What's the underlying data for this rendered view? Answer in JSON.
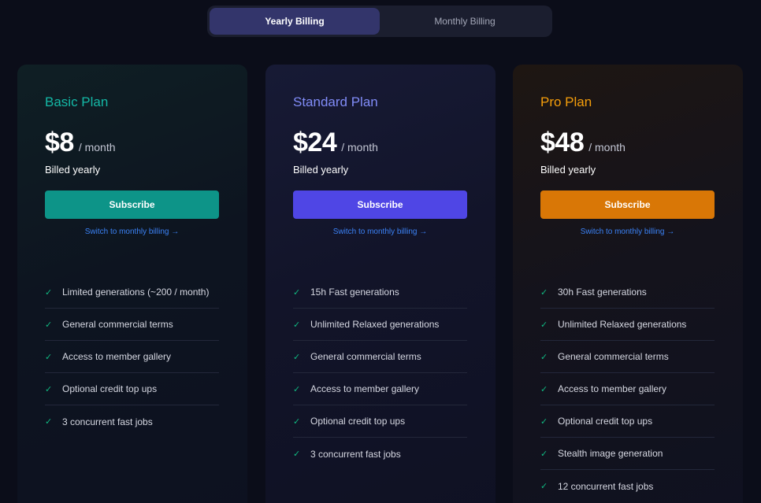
{
  "billing_toggle": {
    "yearly_label": "Yearly Billing",
    "monthly_label": "Monthly Billing",
    "selected": "yearly"
  },
  "colors": {
    "basic_accent": "#14b8a6",
    "basic_button": "#0d9488",
    "standard_accent": "#818cf8",
    "standard_button": "#4f46e5",
    "pro_accent": "#f59e0b",
    "pro_button": "#d97706",
    "check": "#10b981",
    "link": "#3b82f6"
  },
  "plans": [
    {
      "name": "Basic Plan",
      "price": "$8",
      "period": "/ month",
      "billed": "Billed yearly",
      "button": "Subscribe",
      "switch_link": "Switch to monthly billing →",
      "features": [
        "Limited generations (~200 / month)",
        "General commercial terms",
        "Access to member gallery",
        "Optional credit top ups",
        "3 concurrent fast jobs"
      ]
    },
    {
      "name": "Standard Plan",
      "price": "$24",
      "period": "/ month",
      "billed": "Billed yearly",
      "button": "Subscribe",
      "switch_link": "Switch to monthly billing →",
      "features": [
        "15h Fast generations",
        "Unlimited Relaxed generations",
        "General commercial terms",
        "Access to member gallery",
        "Optional credit top ups",
        "3 concurrent fast jobs"
      ]
    },
    {
      "name": "Pro Plan",
      "price": "$48",
      "period": "/ month",
      "billed": "Billed yearly",
      "button": "Subscribe",
      "switch_link": "Switch to monthly billing →",
      "features": [
        "30h Fast generations",
        "Unlimited Relaxed generations",
        "General commercial terms",
        "Access to member gallery",
        "Optional credit top ups",
        "Stealth image generation",
        "12 concurrent fast jobs"
      ]
    }
  ]
}
